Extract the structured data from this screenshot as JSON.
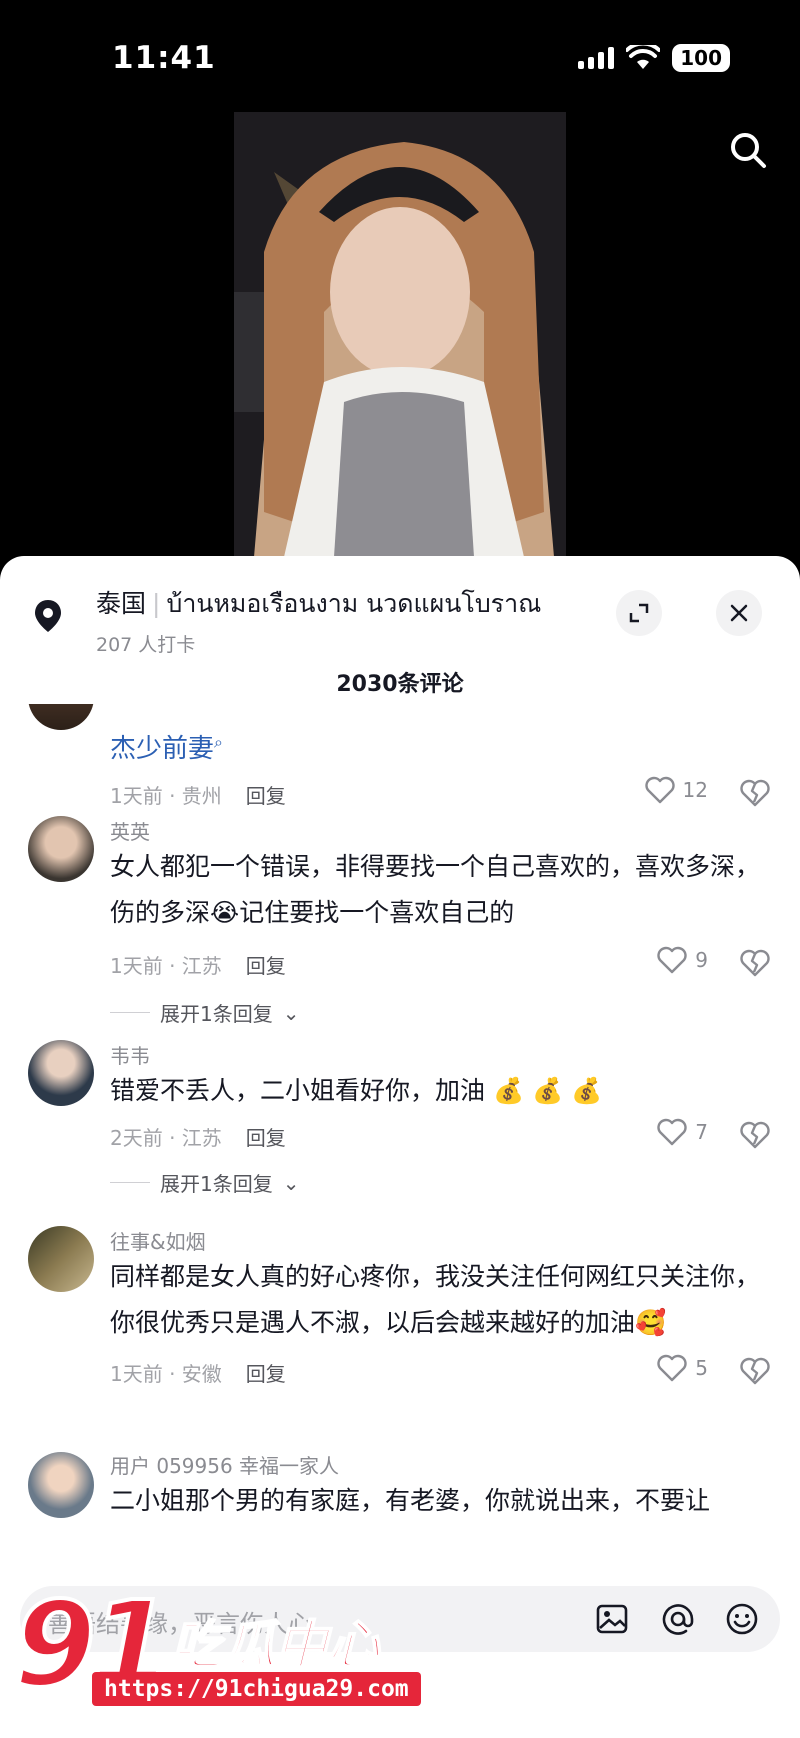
{
  "status_bar": {
    "time": "11:41",
    "battery": "100"
  },
  "location": {
    "title": "泰国",
    "place": "บ้านหมอเรือนงาม นวดแผนโบราณ",
    "checkins": "207 人打卡"
  },
  "comment_count": "2030条评论",
  "comments": [
    {
      "user": "",
      "text": "杰少前妻",
      "time_loc": "1天前 · 贵州",
      "reply_label": "回复",
      "likes": "12",
      "expand": ""
    },
    {
      "user": "英英",
      "text": "女人都犯一个错误，非得要找一个自己喜欢的，喜欢多深，伤的多深😭记住要找一个喜欢自己的",
      "time_loc": "1天前 · 江苏",
      "reply_label": "回复",
      "likes": "9",
      "expand": "展开1条回复"
    },
    {
      "user": "韦韦",
      "text": "错爱不丢人，二小姐看好你，加油 💰 💰 💰",
      "time_loc": "2天前 · 江苏",
      "reply_label": "回复",
      "likes": "7",
      "expand": "展开1条回复"
    },
    {
      "user": "往事&如烟",
      "text": "同样都是女人真的好心疼你，我没关注任何网红只关注你，你很优秀只是遇人不淑，以后会越来越好的加油🥰",
      "time_loc": "1天前 · 安徽",
      "reply_label": "回复",
      "likes": "5",
      "expand": ""
    },
    {
      "user": "用户 059956 幸福一家人",
      "text": "二小姐那个男的有家庭，有老婆，你就说出来，不要让",
      "time_loc": "",
      "reply_label": "",
      "likes": "",
      "expand": ""
    }
  ],
  "input": {
    "placeholder": "善语结善缘，恶言伤人心"
  },
  "watermark": {
    "logo_number": "91",
    "logo_text": "吃瓜中心",
    "url": "https://91chigua29.com"
  },
  "colors": {
    "accent_link": "#2b5fb3",
    "watermark_red": "#e5263a"
  }
}
